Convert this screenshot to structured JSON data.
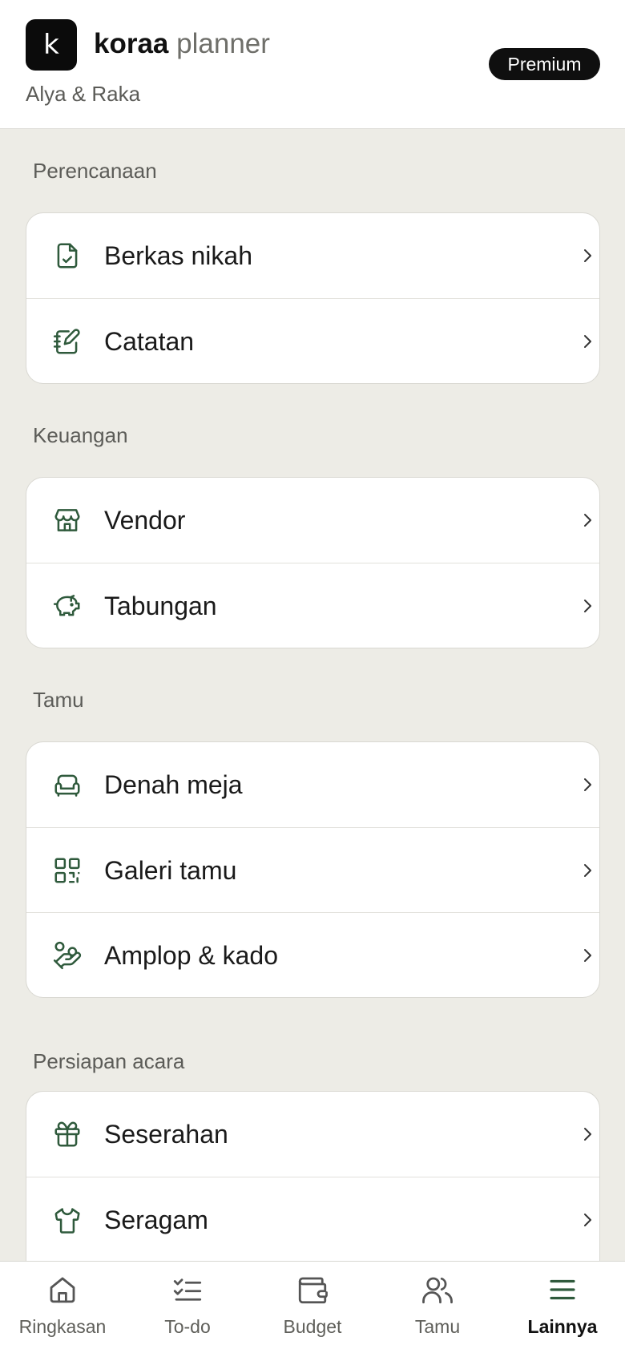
{
  "header": {
    "logo_letter": "k",
    "brand_bold": "koraa",
    "brand_light": "planner",
    "couple": "Alya & Raka",
    "badge": "Premium"
  },
  "sections": [
    {
      "title": "Perencanaan",
      "items": [
        {
          "label": "Berkas nikah",
          "icon": "file-check-icon"
        },
        {
          "label": "Catatan",
          "icon": "notebook-pen-icon"
        }
      ]
    },
    {
      "title": "Keuangan",
      "items": [
        {
          "label": "Vendor",
          "icon": "store-icon"
        },
        {
          "label": "Tabungan",
          "icon": "piggy-bank-icon"
        }
      ]
    },
    {
      "title": "Tamu",
      "items": [
        {
          "label": "Denah meja",
          "icon": "sofa-icon"
        },
        {
          "label": "Galeri tamu",
          "icon": "qr-code-icon"
        },
        {
          "label": "Amplop & kado",
          "icon": "hand-coins-icon"
        }
      ]
    },
    {
      "title": "Persiapan acara",
      "items": [
        {
          "label": "Seserahan",
          "icon": "gift-icon"
        },
        {
          "label": "Seragam",
          "icon": "shirt-icon"
        }
      ]
    }
  ],
  "tabbar": [
    {
      "label": "Ringkasan",
      "icon": "home-icon"
    },
    {
      "label": "To-do",
      "icon": "checklist-icon"
    },
    {
      "label": "Budget",
      "icon": "wallet-icon"
    },
    {
      "label": "Tamu",
      "icon": "users-icon"
    },
    {
      "label": "Lainnya",
      "icon": "menu-icon",
      "active": true
    }
  ],
  "colors": {
    "icon_green": "#2f5a3c",
    "background": "#edece6",
    "badge": "#0f0f0f"
  }
}
